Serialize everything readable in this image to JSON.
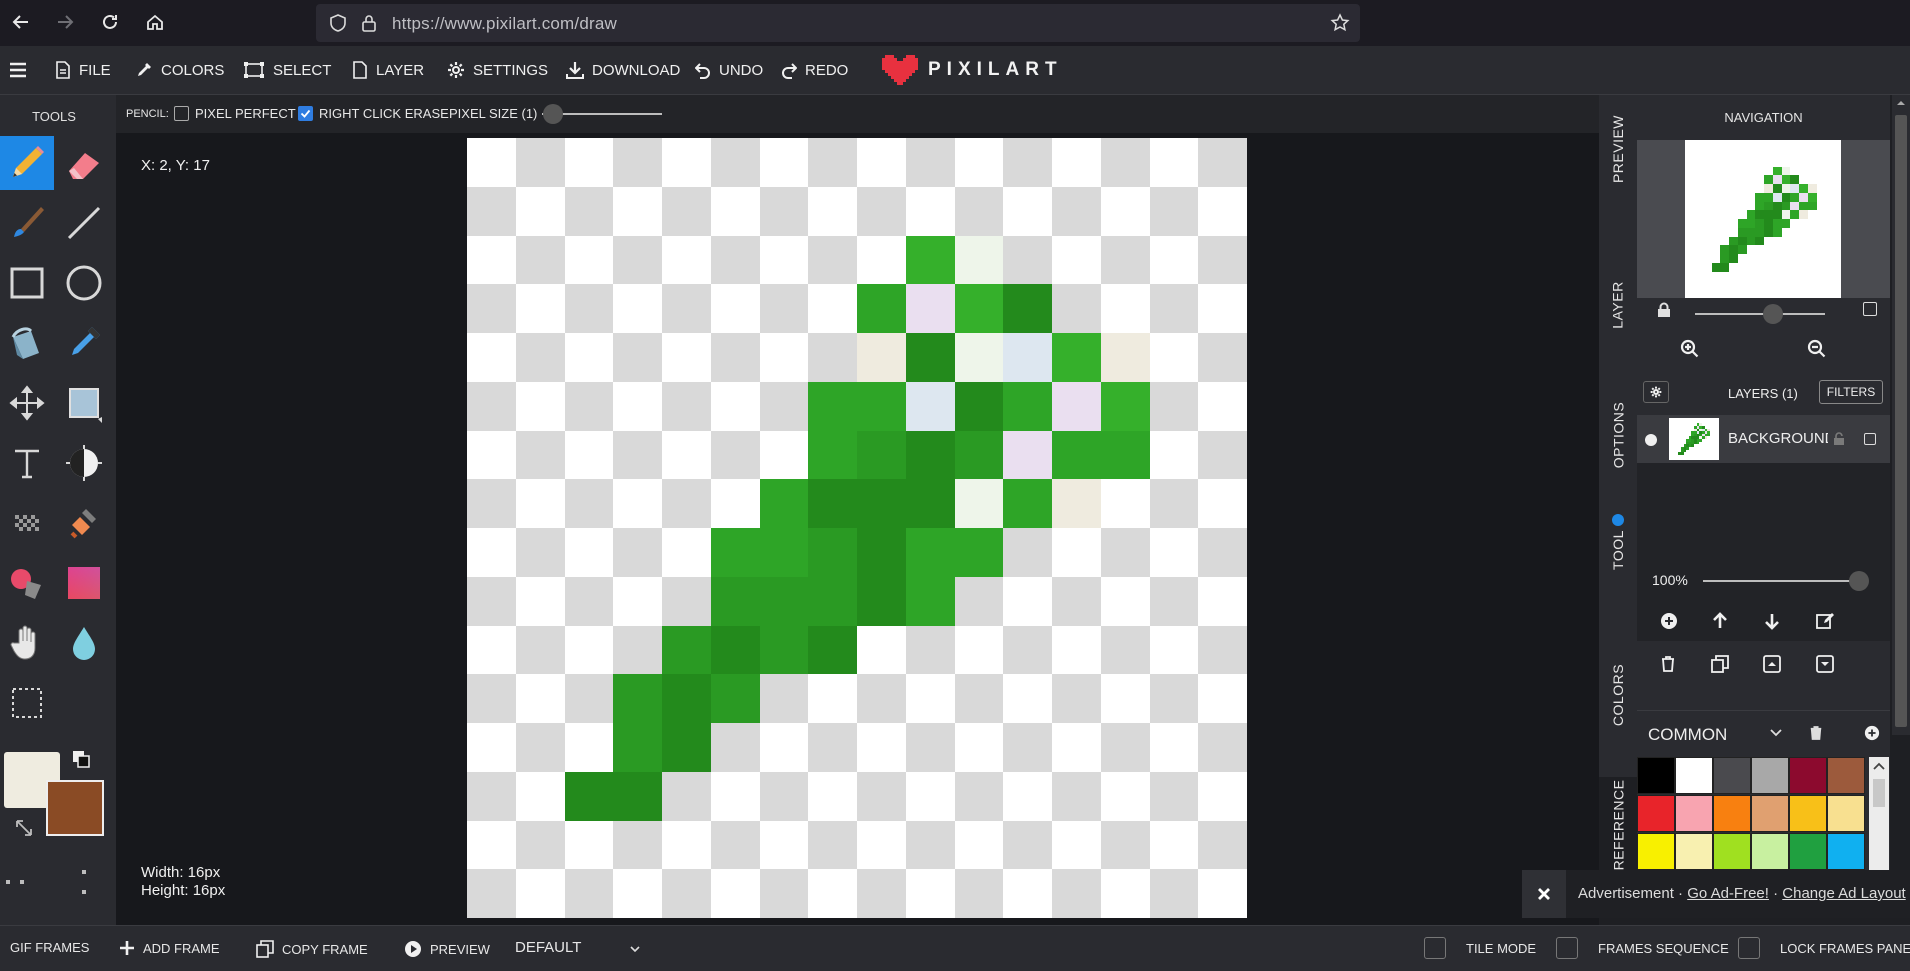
{
  "browser": {
    "url": "https://www.pixilart.com/draw"
  },
  "menu": {
    "items": [
      {
        "label": "FILE",
        "icon": "file-icon"
      },
      {
        "label": "COLORS",
        "icon": "eyedropper-icon"
      },
      {
        "label": "SELECT",
        "icon": "select-icon"
      },
      {
        "label": "LAYER",
        "icon": "layer-icon"
      },
      {
        "label": "SETTINGS",
        "icon": "gear-icon"
      },
      {
        "label": "DOWNLOAD",
        "icon": "download-icon"
      },
      {
        "label": "UNDO",
        "icon": "undo-icon"
      },
      {
        "label": "REDO",
        "icon": "redo-icon"
      }
    ],
    "logo_text": "PIXILART"
  },
  "tools": {
    "title": "TOOLS",
    "primary_color": "#efece0",
    "secondary_color": "#8a4b25",
    "items": [
      "pencil-icon",
      "eraser-icon",
      "paintbrush-icon",
      "line-icon",
      "rectangle-icon",
      "circle-icon",
      "bucket-icon",
      "eyedropper-icon",
      "move-icon",
      "shade-icon",
      "text-icon",
      "dither-icon",
      "pattern-icon",
      "stamp-icon",
      "color-replace-icon",
      "gradient-icon",
      "hand-icon",
      "blur-icon",
      "select-icon"
    ]
  },
  "options": {
    "tool_label": "PENCIL:",
    "pixel_perfect": "PIXEL PERFECT",
    "pixel_perfect_checked": false,
    "right_click_erase": "RIGHT CLICK ERASE",
    "right_click_erase_checked": true,
    "pixel_size": "PIXEL SIZE (1)"
  },
  "canvas": {
    "coords": "X: 2, Y: 17",
    "width_text": "Width: 16px",
    "height_text": "Height: 16px",
    "size": 16,
    "pixels": [
      [
        9,
        2,
        "#35b02b"
      ],
      [
        10,
        2,
        "#eef5ea"
      ],
      [
        8,
        3,
        "#2ea527"
      ],
      [
        9,
        3,
        "#eadff0"
      ],
      [
        10,
        3,
        "#35b02b"
      ],
      [
        11,
        3,
        "#238a1c"
      ],
      [
        8,
        4,
        "#efebdf"
      ],
      [
        9,
        4,
        "#238a1c"
      ],
      [
        10,
        4,
        "#eef5ea"
      ],
      [
        11,
        4,
        "#dde7f0"
      ],
      [
        12,
        4,
        "#35b02b"
      ],
      [
        13,
        4,
        "#efebdf"
      ],
      [
        7,
        5,
        "#2ea527"
      ],
      [
        8,
        5,
        "#2ea527"
      ],
      [
        9,
        5,
        "#dde7f0"
      ],
      [
        10,
        5,
        "#238a1c"
      ],
      [
        11,
        5,
        "#2ea527"
      ],
      [
        12,
        5,
        "#eadff0"
      ],
      [
        13,
        5,
        "#35b02b"
      ],
      [
        7,
        6,
        "#2ea527"
      ],
      [
        8,
        6,
        "#2a9a23"
      ],
      [
        9,
        6,
        "#238a1c"
      ],
      [
        10,
        6,
        "#2a9a23"
      ],
      [
        11,
        6,
        "#eadff0"
      ],
      [
        12,
        6,
        "#2ea527"
      ],
      [
        13,
        6,
        "#2ea527"
      ],
      [
        6,
        7,
        "#2ea527"
      ],
      [
        7,
        7,
        "#238a1c"
      ],
      [
        8,
        7,
        "#238a1c"
      ],
      [
        9,
        7,
        "#238a1c"
      ],
      [
        10,
        7,
        "#eef5ea"
      ],
      [
        11,
        7,
        "#2ea527"
      ],
      [
        12,
        7,
        "#efebdf"
      ],
      [
        5,
        8,
        "#2ea527"
      ],
      [
        6,
        8,
        "#2ea527"
      ],
      [
        7,
        8,
        "#2a9a23"
      ],
      [
        8,
        8,
        "#238a1c"
      ],
      [
        9,
        8,
        "#2ea527"
      ],
      [
        10,
        8,
        "#2ea527"
      ],
      [
        5,
        9,
        "#2a9a23"
      ],
      [
        6,
        9,
        "#2a9a23"
      ],
      [
        7,
        9,
        "#2a9a23"
      ],
      [
        8,
        9,
        "#238a1c"
      ],
      [
        9,
        9,
        "#2ea527"
      ],
      [
        4,
        10,
        "#2a9a23"
      ],
      [
        5,
        10,
        "#238a1c"
      ],
      [
        6,
        10,
        "#2a9a23"
      ],
      [
        7,
        10,
        "#238a1c"
      ],
      [
        3,
        11,
        "#2a9a23"
      ],
      [
        4,
        11,
        "#238a1c"
      ],
      [
        5,
        11,
        "#2a9a23"
      ],
      [
        3,
        12,
        "#2a9a23"
      ],
      [
        4,
        12,
        "#238a1c"
      ],
      [
        2,
        13,
        "#238a1c"
      ],
      [
        3,
        13,
        "#238a1c"
      ]
    ]
  },
  "right_tabs": [
    "PREVIEW",
    "LAYER",
    "OPTIONS",
    "TOOL",
    "COLORS",
    "REFERENCE"
  ],
  "navigation": {
    "title": "NAVIGATION",
    "zoom_level": 0.6
  },
  "layers": {
    "title": "LAYERS (1)",
    "filters": "FILTERS",
    "layer_name": "BACKGROUND",
    "opacity": "100%",
    "opacity_level": 1.0
  },
  "palette": {
    "name": "COMMON",
    "colors": [
      "#000000",
      "#ffffff",
      "#4a4a4e",
      "#a8a8a8",
      "#8c0a2e",
      "#9c5a3c",
      "#e8242a",
      "#f8a4b0",
      "#f88010",
      "#e0a070",
      "#f8c018",
      "#f8e090",
      "#f8f000",
      "#f8f0b0",
      "#a0e020",
      "#c8f0a0",
      "#20a040",
      "#10b0f0"
    ]
  },
  "ad": {
    "label": "Advertisement ·",
    "go_ad_free": "Go Ad-Free!",
    "separator": "·",
    "change_layout": "Change Ad Layout"
  },
  "frames": {
    "gif_frames": "GIF FRAMES",
    "add_frame": "ADD FRAME",
    "copy_frame": "COPY FRAME",
    "preview": "PREVIEW",
    "default": "DEFAULT",
    "tile_mode": "TILE MODE",
    "frames_sequence": "FRAMES SEQUENCE",
    "lock_frames_panel": "LOCK FRAMES PANEL"
  }
}
